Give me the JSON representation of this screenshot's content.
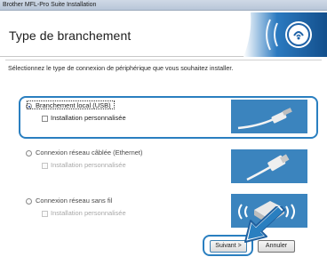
{
  "window": {
    "title": "Brother MFL-Pro Suite Installation"
  },
  "header": {
    "title": "Type de branchement"
  },
  "instruction": "Sélectionnez le type de connexion de périphérique que vous souhaitez installer.",
  "options": [
    {
      "label": "Branchement local (USB)",
      "selected": true,
      "custom_label": "Installation personnalisée",
      "custom_enabled": true
    },
    {
      "label": "Connexion réseau câblée (Ethernet)",
      "selected": false,
      "custom_label": "Installation personnalisée",
      "custom_enabled": false
    },
    {
      "label": "Connexion réseau sans fil",
      "selected": false,
      "custom_label": "Installation personnalisée",
      "custom_enabled": false
    }
  ],
  "buttons": {
    "next": "Suivant >",
    "cancel": "Annuler"
  },
  "colors": {
    "accent": "#2a7fc0",
    "logo_blue": "#1f63a8",
    "header_bg": "#ffffff"
  },
  "icons": {
    "logo": "wireless-logo-icon",
    "usb": "usb-cable-icon",
    "ethernet": "ethernet-cable-icon",
    "wireless": "wireless-printer-icon",
    "pointer": "pointer-arrow-icon"
  }
}
